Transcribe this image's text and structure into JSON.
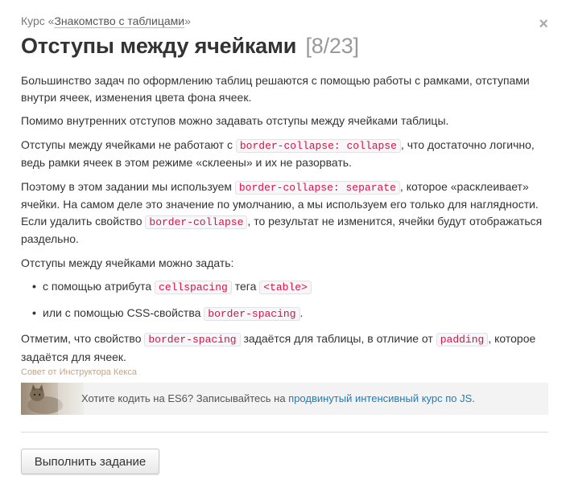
{
  "header": {
    "course_prefix": "Курс «",
    "course_name": "Знакомство с таблицами",
    "course_suffix": "»",
    "close_glyph": "×",
    "title": "Отступы между ячейками",
    "counter": "[8/23]"
  },
  "content": {
    "p1": "Большинство задач по оформлению таблиц решаются с помощью работы с рамками, отступами внутри ячеек, изменения цвета фона ячеек.",
    "p2": "Помимо внутренних отступов можно задавать отступы между ячейками таблицы.",
    "p3_a": "Отступы между ячейками не работают с ",
    "p3_code": "border-collapse: collapse",
    "p3_b": ", что достаточно логично, ведь рамки ячеек в этом режиме «склеены» и их не разорвать.",
    "p4_a": "Поэтому в этом задании мы используем ",
    "p4_code1": "border-collapse: separate",
    "p4_b": ", которое «расклеивает» ячейки. На самом деле это значение по умолчанию, а мы используем его только для наглядности. Если удалить свойство ",
    "p4_code2": "border-collapse",
    "p4_c": ", то результат не изменится, ячейки будут отображаться раздельно.",
    "p5": "Отступы между ячейками можно задать:",
    "bullet": "•",
    "li1_a": "с помощью атрибута ",
    "li1_code1": "cellspacing",
    "li1_b": " тега ",
    "li1_code2": "<table>",
    "li2_a": "или с помощью CSS-свойства ",
    "li2_code": "border-spacing",
    "li2_b": ".",
    "p6_a": "Отметим, что свойство ",
    "p6_code1": "border-spacing",
    "p6_b": " задаётся для таблицы, в отличие от ",
    "p6_code2": "padding",
    "p6_c": ", которое задаётся для ячеек."
  },
  "tip": {
    "caption": "Совет от Инструктора Кекса",
    "text": "Хотите кодить на ES6? Записывайтесь на ",
    "link": "продвинутый интенсивный курс по JS",
    "suffix": "."
  },
  "actions": {
    "run_label": "Выполнить задание"
  }
}
